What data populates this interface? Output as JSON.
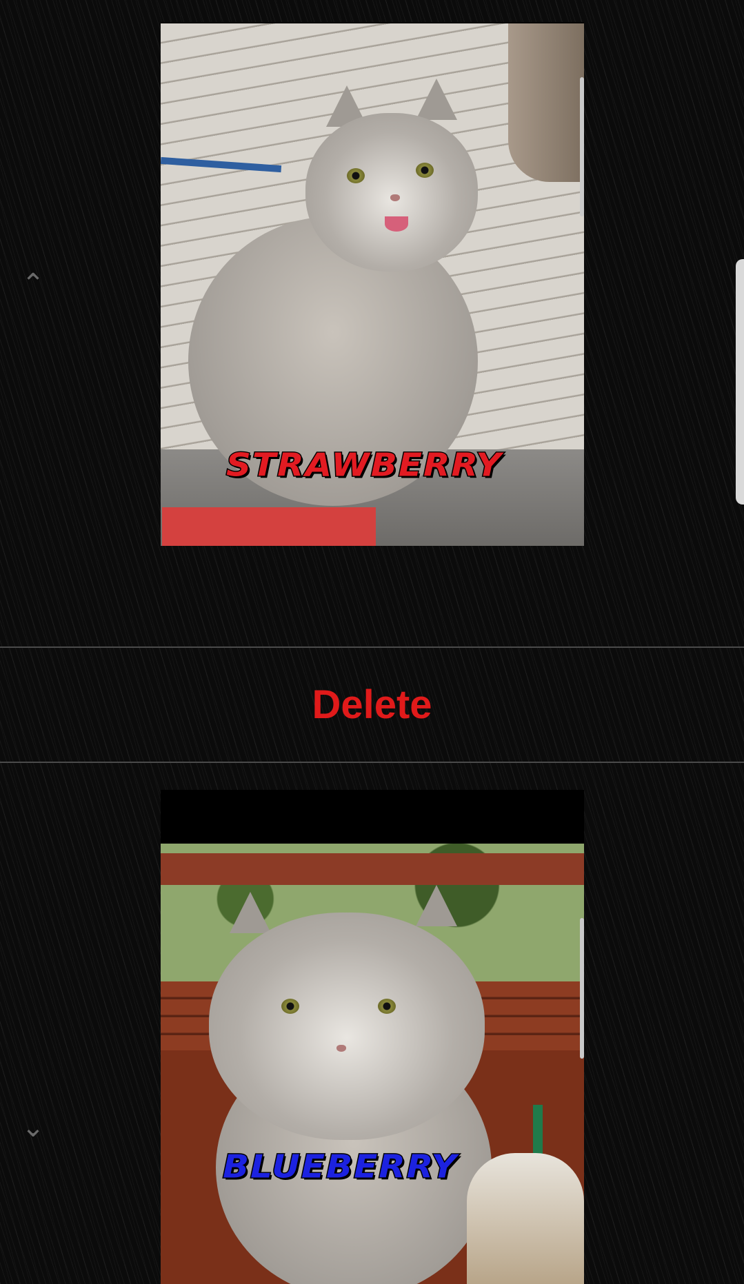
{
  "cards": [
    {
      "label": "STRAWBERRY",
      "label_color": "#e21b22"
    },
    {
      "label": "BLUEBERRY",
      "label_color": "#1c22e0"
    }
  ],
  "delete_button": {
    "label": "Delete",
    "color": "#e01a1a"
  },
  "icons": {
    "scroll_up": "chevron-up-icon",
    "scroll_down": "chevron-down-icon"
  }
}
